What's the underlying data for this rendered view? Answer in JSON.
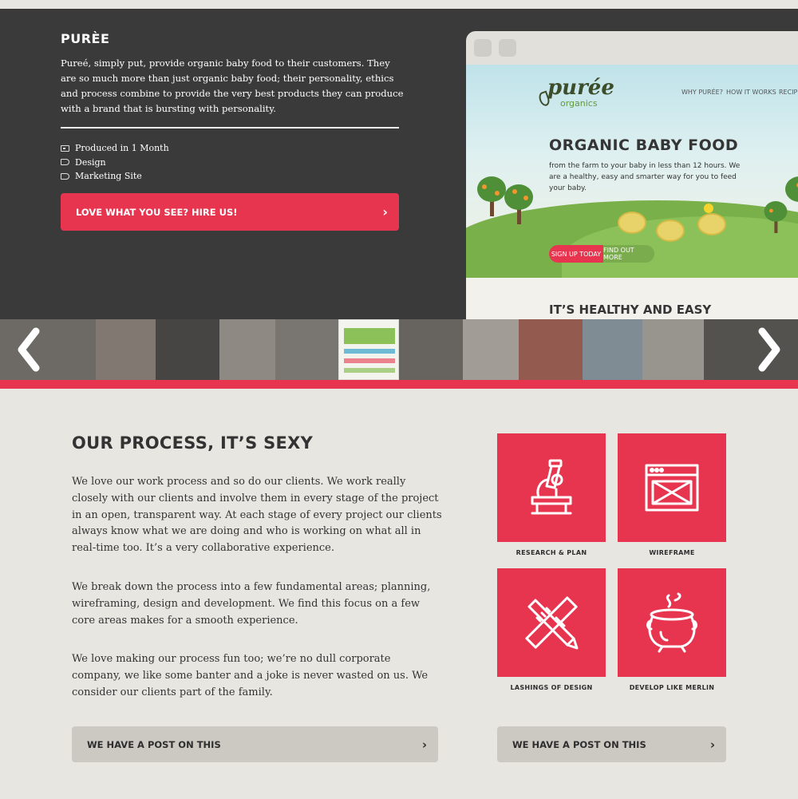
{
  "project": {
    "title": "PURÈE",
    "description": "Pureé, simply put, provide organic baby food to their customers. They are so much more than just organic baby food; their personality, ethics and process combine to provide the very best products they can produce with a brand that is bursting with personality.",
    "meta": [
      {
        "icon": "calendar-icon",
        "label": "Produced in 1 Month"
      },
      {
        "icon": "tag-icon",
        "label": "Design"
      },
      {
        "icon": "tag-icon",
        "label": "Marketing Site"
      }
    ],
    "hire_button": "LOVE WHAT YOU SEE? HIRE US!"
  },
  "preview": {
    "logo": "purée",
    "logo_sub": "organics",
    "nav": [
      "WHY PURÉE?",
      "HOW IT WORKS",
      "RECIPES"
    ],
    "headline": "ORGANIC BABY FOOD",
    "subtext": "from the farm to your baby in less than 12 hours. We are a healthy, easy and smarter way for you to feed your baby.",
    "signup": "SIGN UP TODAY",
    "findout": "FIND OUT MORE",
    "section_title": "IT’S HEALTHY AND EASY"
  },
  "carousel": {
    "prev_icon": "chevron-left-icon",
    "next_icon": "chevron-right-icon"
  },
  "process": {
    "title": "OUR PROCESS, IT’S SEXY",
    "paragraphs": [
      "We love our work process and so do our clients. We work really closely with our clients and involve them in every stage of the project in an open, transparent way. At each stage of every project our clients always know what we are doing and who is working on what all in real-time too. It’s a very collaborative experience.",
      "We break down the process into a few fundamental areas; planning, wireframing, design and development. We find this focus on a few core areas makes for a smooth experience.",
      "We love making our process fun too; we’re no dull corporate company, we like some banter and a joke is never wasted on us. We consider our clients part of the family."
    ],
    "tiles": [
      {
        "icon": "microscope-icon",
        "label": "RESEARCH & PLAN"
      },
      {
        "icon": "browser-window-icon",
        "label": "WIREFRAME"
      },
      {
        "icon": "pencil-ruler-icon",
        "label": "LASHINGS OF DESIGN"
      },
      {
        "icon": "cauldron-icon",
        "label": "DEVELOP LIKE MERLIN"
      }
    ],
    "post_button_left": "WE HAVE A POST ON THIS",
    "post_button_right": "WE HAVE A POST ON THIS"
  },
  "colors": {
    "accent": "#e8354f",
    "hero_bg": "#3b3a3a",
    "page_bg": "#e8e6e1"
  }
}
